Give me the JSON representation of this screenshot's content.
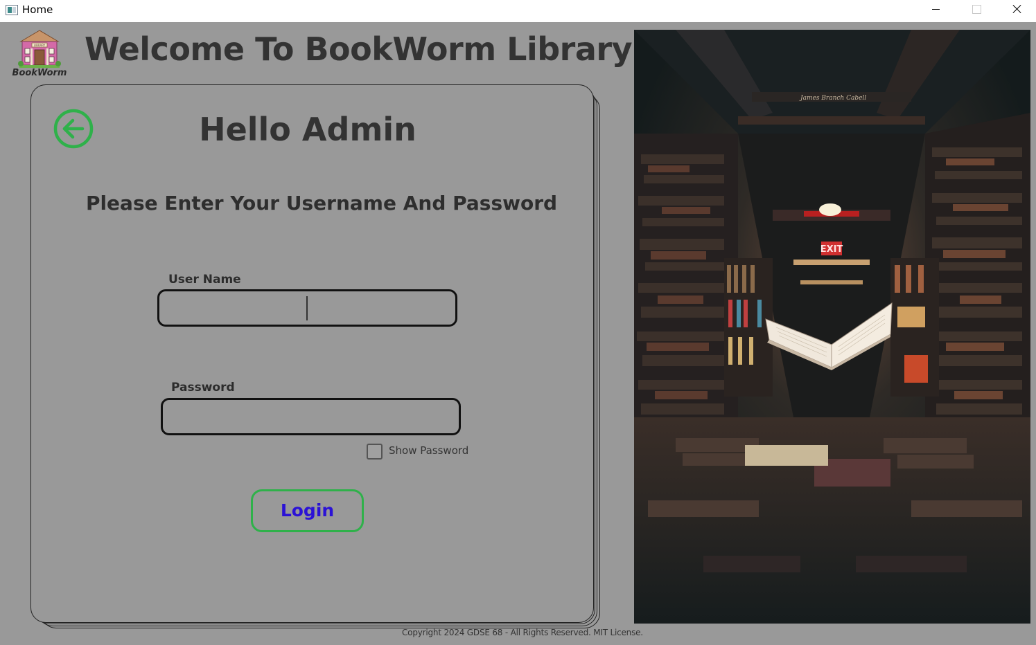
{
  "window": {
    "title": "Home"
  },
  "header": {
    "logo_text": "BookWorm",
    "logo_sign": "LIBRARY",
    "title": "Welcome To BookWorm Library"
  },
  "card": {
    "heading": "Hello Admin",
    "instruction": "Please Enter Your Username And Password",
    "username_label": "User Name",
    "username_value": "",
    "password_label": "Password",
    "password_value": "",
    "show_password_label": "Show Password",
    "show_password_checked": false,
    "login_label": "Login"
  },
  "photo": {
    "exit_sign": "EXIT",
    "spine_text": "James Branch Cabell"
  },
  "footer": {
    "copyright": "Copyright 2024 GDSE 68 - All Rights Reserved. MIT License."
  },
  "colors": {
    "background": "#999999",
    "title_text": "#333333",
    "accent_green": "#2fb14a",
    "login_text": "#2b12d6",
    "field_border": "#111111"
  },
  "icons": {
    "back": "arrow-left-circle-icon",
    "logo": "library-building-icon",
    "app": "window-app-icon"
  }
}
